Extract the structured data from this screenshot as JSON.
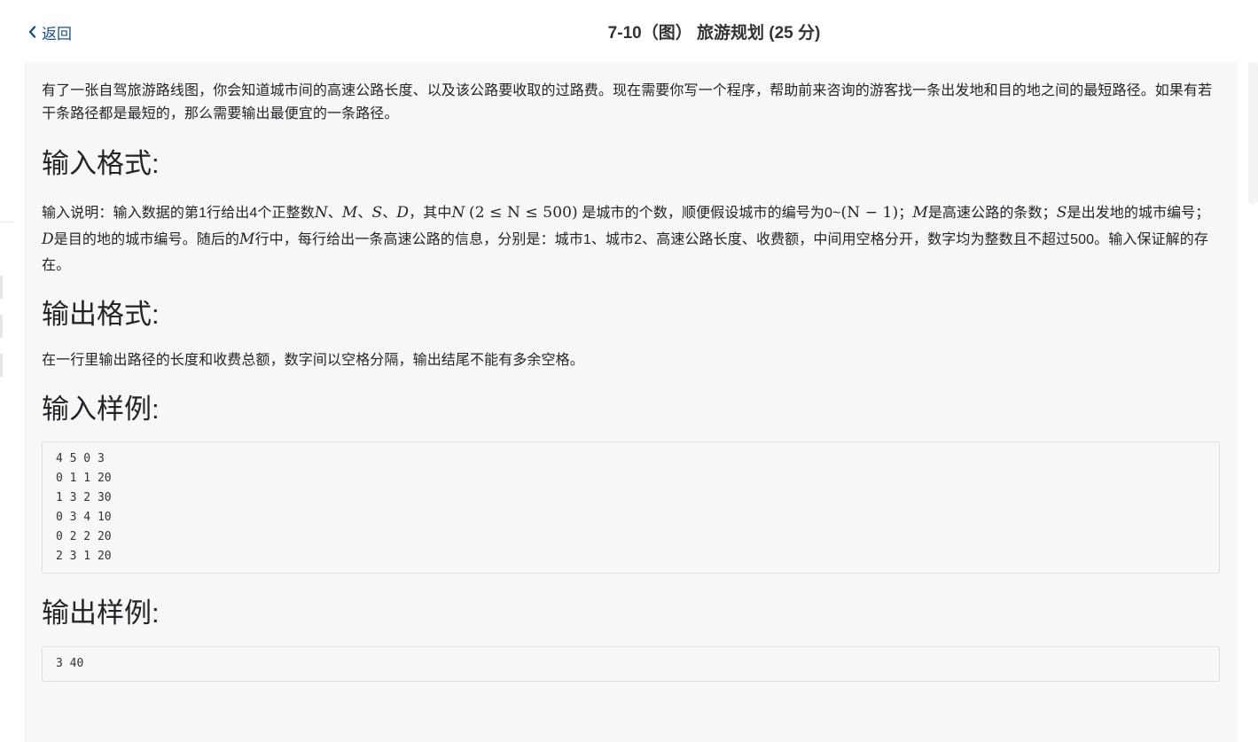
{
  "header": {
    "back_label": "返回",
    "title": "7-10（图） 旅游规划 (25 分)"
  },
  "problem": {
    "description": "有了一张自驾旅游路线图，你会知道城市间的高速公路长度、以及该公路要收取的过路费。现在需要你写一个程序，帮助前来咨询的游客找一条出发地和目的地之间的最短路径。如果有若干条路径都是最短的，那么需要输出最便宜的一条路径。",
    "input_heading": "输入格式:",
    "input_text": {
      "t1": "输入说明：输入数据的第1行给出4个正整数",
      "vN": "N",
      "sep1": "、",
      "vM": "M",
      "sep2": "、",
      "vS": "S",
      "sep3": "、",
      "vD": "D",
      "t2": "，其中",
      "vN2": "N",
      "range": "(2 ≤ N ≤ 500)",
      "t3": "是城市的个数，顺便假设城市的编号为0~",
      "expr": "(N − 1)",
      "t4": "；",
      "vM2": "M",
      "t5": "是高速公路的条数；",
      "vS2": "S",
      "t6": "是出发地的城市编号；",
      "vD2": "D",
      "t7": "是目的地的城市编号。随后的",
      "vM3": "M",
      "t8": "行中，每行给出一条高速公路的信息，分别是：城市1、城市2、高速公路长度、收费额，中间用空格分开，数字均为整数且不超过500。输入保证解的存在。"
    },
    "output_heading": "输出格式:",
    "output_text": "在一行里输出路径的长度和收费总额，数字间以空格分隔，输出结尾不能有多余空格。",
    "sample_input_heading": "输入样例:",
    "sample_input": "4 5 0 3\n0 1 1 20\n1 3 2 30\n0 3 4 10\n0 2 2 20\n2 3 1 20",
    "sample_output_heading": "输出样例:",
    "sample_output": "3 40"
  },
  "icons": {
    "back": "chevron-left-icon"
  },
  "colors": {
    "link": "#1c4f86",
    "panel_bg": "#f7f7f7",
    "code_border": "#dddddd"
  }
}
